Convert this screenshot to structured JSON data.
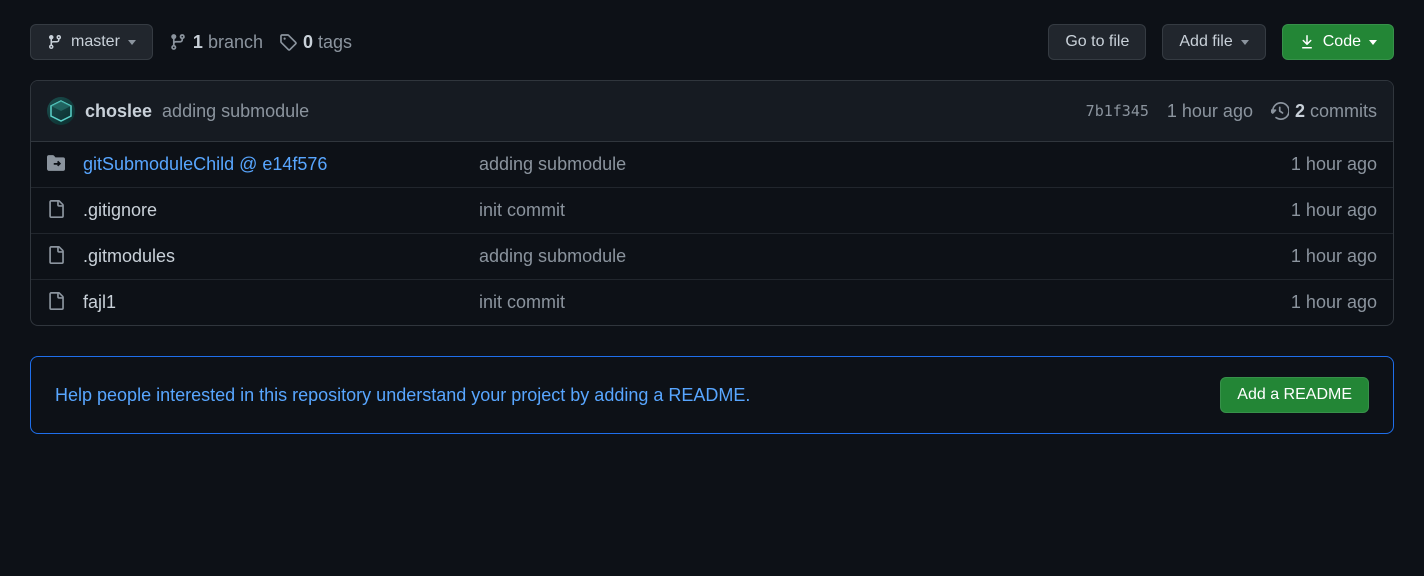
{
  "branch": {
    "current": "master"
  },
  "stats": {
    "branch_count": "1",
    "branch_label": "branch",
    "tag_count": "0",
    "tag_label": "tags"
  },
  "actions": {
    "goto_file": "Go to file",
    "add_file": "Add file",
    "code": "Code"
  },
  "latest_commit": {
    "author": "choslee",
    "message": "adding submodule",
    "sha": "7b1f345",
    "time": "1 hour ago",
    "commits_count": "2",
    "commits_label": "commits"
  },
  "files": [
    {
      "type": "submodule",
      "name": "gitSubmoduleChild @ e14f576",
      "message": "adding submodule",
      "time": "1 hour ago"
    },
    {
      "type": "file",
      "name": ".gitignore",
      "message": "init commit",
      "time": "1 hour ago"
    },
    {
      "type": "file",
      "name": ".gitmodules",
      "message": "adding submodule",
      "time": "1 hour ago"
    },
    {
      "type": "file",
      "name": "fajl1",
      "message": "init commit",
      "time": "1 hour ago"
    }
  ],
  "readme_banner": {
    "text": "Help people interested in this repository understand your project by adding a README.",
    "button": "Add a README"
  }
}
